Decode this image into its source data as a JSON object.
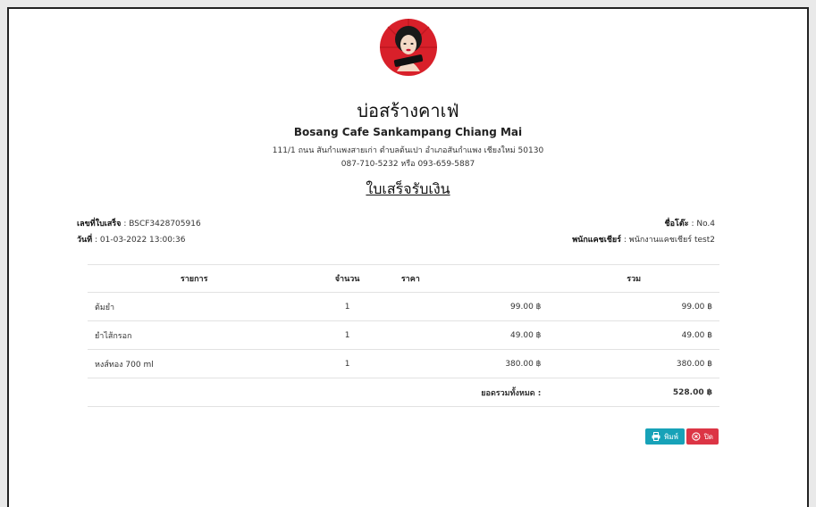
{
  "shop": {
    "name": "บ่อสร้างคาเฟ่",
    "branch": "Bosang Cafe Sankampang Chiang Mai",
    "address": "111/1 ถนน สันกำแพงสายเก่า ตำบลต้นเปา อำเภอสันกำแพง เชียงใหม่ 50130",
    "phone": "087-710-5232 หรือ 093-659-5887",
    "logo_icon": "cafe-logo-woman-portrait"
  },
  "document": {
    "title": "ใบเสร็จรับเงิน"
  },
  "info": {
    "receipt_no_label": "เลขที่ใบเสร็จ",
    "receipt_no": " : BSCF3428705916",
    "date_label": "วันที่",
    "date": " : 01-03-2022 13:00:36",
    "table_label": "ชื่อโต๊ะ",
    "table": " : No.4",
    "cashier_label": "พนักแคชเชียร์",
    "cashier": " : พนักงานแคชเชียร์ test2"
  },
  "table": {
    "headers": [
      "รายการ",
      "จำนวน",
      "ราคา",
      "รวม"
    ],
    "rows": [
      {
        "name": "ต้มยำ",
        "qty": "1",
        "price": "99.00 ฿",
        "total": "99.00 ฿"
      },
      {
        "name": "ยำไส้กรอก",
        "qty": "1",
        "price": "49.00 ฿",
        "total": "49.00 ฿"
      },
      {
        "name": "หงส์ทอง 700 ml",
        "qty": "1",
        "price": "380.00 ฿",
        "total": "380.00 ฿"
      }
    ],
    "grand_total_label": "ยอดรวมทั้งหมด :",
    "grand_total": "528.00 ฿"
  },
  "buttons": {
    "print_label": "พิมพ์",
    "close_label": "ปิด",
    "print_icon": "printer-icon",
    "close_icon": "close-circle-icon",
    "print_color": "#17a2b8",
    "close_color": "#dc3545"
  }
}
